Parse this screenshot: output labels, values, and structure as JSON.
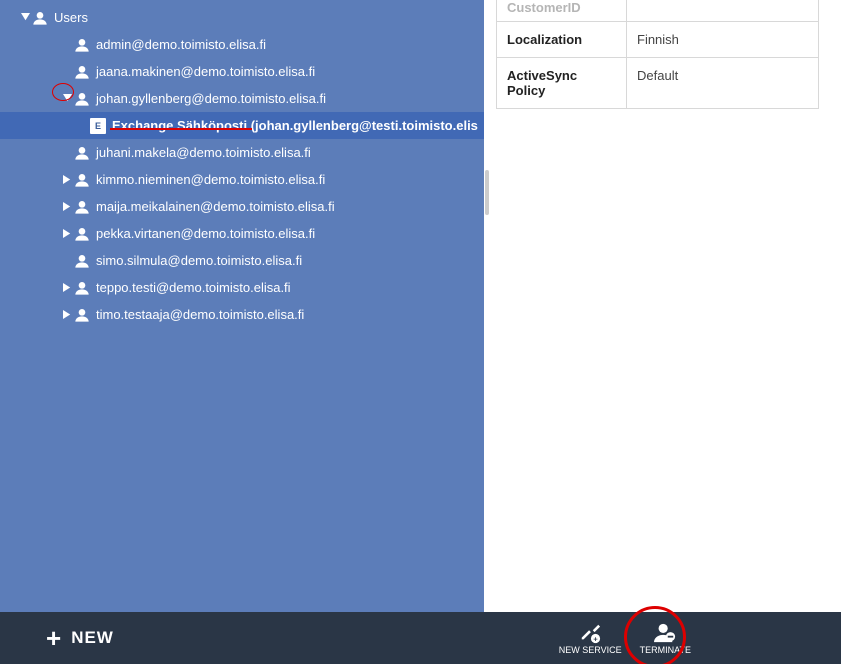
{
  "sidebar": {
    "root": {
      "label": "Users"
    },
    "items": [
      {
        "label": "admin@demo.toimisto.elisa.fi",
        "expandable": false
      },
      {
        "label": "jaana.makinen@demo.toimisto.elisa.fi",
        "expandable": false
      },
      {
        "label": "johan.gyllenberg@demo.toimisto.elisa.fi",
        "expandable": true,
        "expanded": true
      },
      {
        "label": "juhani.makela@demo.toimisto.elisa.fi",
        "expandable": false
      },
      {
        "label": "kimmo.nieminen@demo.toimisto.elisa.fi",
        "expandable": true,
        "expanded": false
      },
      {
        "label": "maija.meikalainen@demo.toimisto.elisa.fi",
        "expandable": true,
        "expanded": false
      },
      {
        "label": "pekka.virtanen@demo.toimisto.elisa.fi",
        "expandable": true,
        "expanded": false
      },
      {
        "label": "simo.silmula@demo.toimisto.elisa.fi",
        "expandable": false
      },
      {
        "label": "teppo.testi@demo.toimisto.elisa.fi",
        "expandable": true,
        "expanded": false
      },
      {
        "label": "timo.testaaja@demo.toimisto.elisa.fi",
        "expandable": true,
        "expanded": false
      }
    ],
    "service": {
      "label": "Exchange Sähköposti (johan.gyllenberg@testi.toimisto.elis"
    }
  },
  "details": {
    "rows": [
      {
        "key": "CustomerID",
        "value": ""
      },
      {
        "key": "Localization",
        "value": "Finnish"
      },
      {
        "key": "ActiveSync Policy",
        "value": "Default"
      }
    ]
  },
  "bottombar": {
    "new_label": "NEW",
    "new_service_label": "NEW SERVICE",
    "terminate_label": "TERMINATE"
  }
}
